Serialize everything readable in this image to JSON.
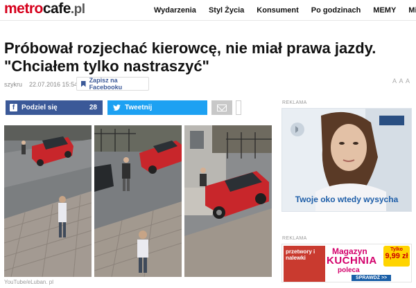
{
  "header": {
    "logo_part1": "metro",
    "logo_part2": "cafe",
    "logo_part3": ".pl",
    "nav": [
      "Wydarzenia",
      "Styl Życia",
      "Konsument",
      "Po godzinach",
      "MEMY",
      "Miasta"
    ]
  },
  "article": {
    "title_line1": "Próbował rozjechać kierowcę, nie miał prawa jazdy.",
    "title_line2": "\"Chciałem tylko nastraszyć\"",
    "author": "szykru",
    "date": "22.07.2016 15:54",
    "save_fb": "Zapisz na Facebooku",
    "font_size_controls": "A A A",
    "photo_credit": "YouTube/eLuban. pl"
  },
  "share": {
    "facebook_label": "Podziel się",
    "facebook_count": "28",
    "twitter_label": "Tweetnij"
  },
  "ads": {
    "label": "REKLAMA",
    "ad1_caption": "Twoje oko wtedy wysycha",
    "ad2_cover_text": "przetwory i nalewki",
    "ad2_line1": "Magazyn",
    "ad2_line2": "KUCHNIA",
    "ad2_line3": "poleca",
    "ad2_price_top": "Tylko",
    "ad2_price": "9,99 zł",
    "ad2_button": "SPRAWDŹ >>"
  },
  "colors": {
    "brand_red": "#d6001c",
    "facebook": "#3b5998",
    "twitter": "#1da1f2",
    "ad_blue": "#1e5ea8",
    "ad_magenta": "#d3006b"
  }
}
